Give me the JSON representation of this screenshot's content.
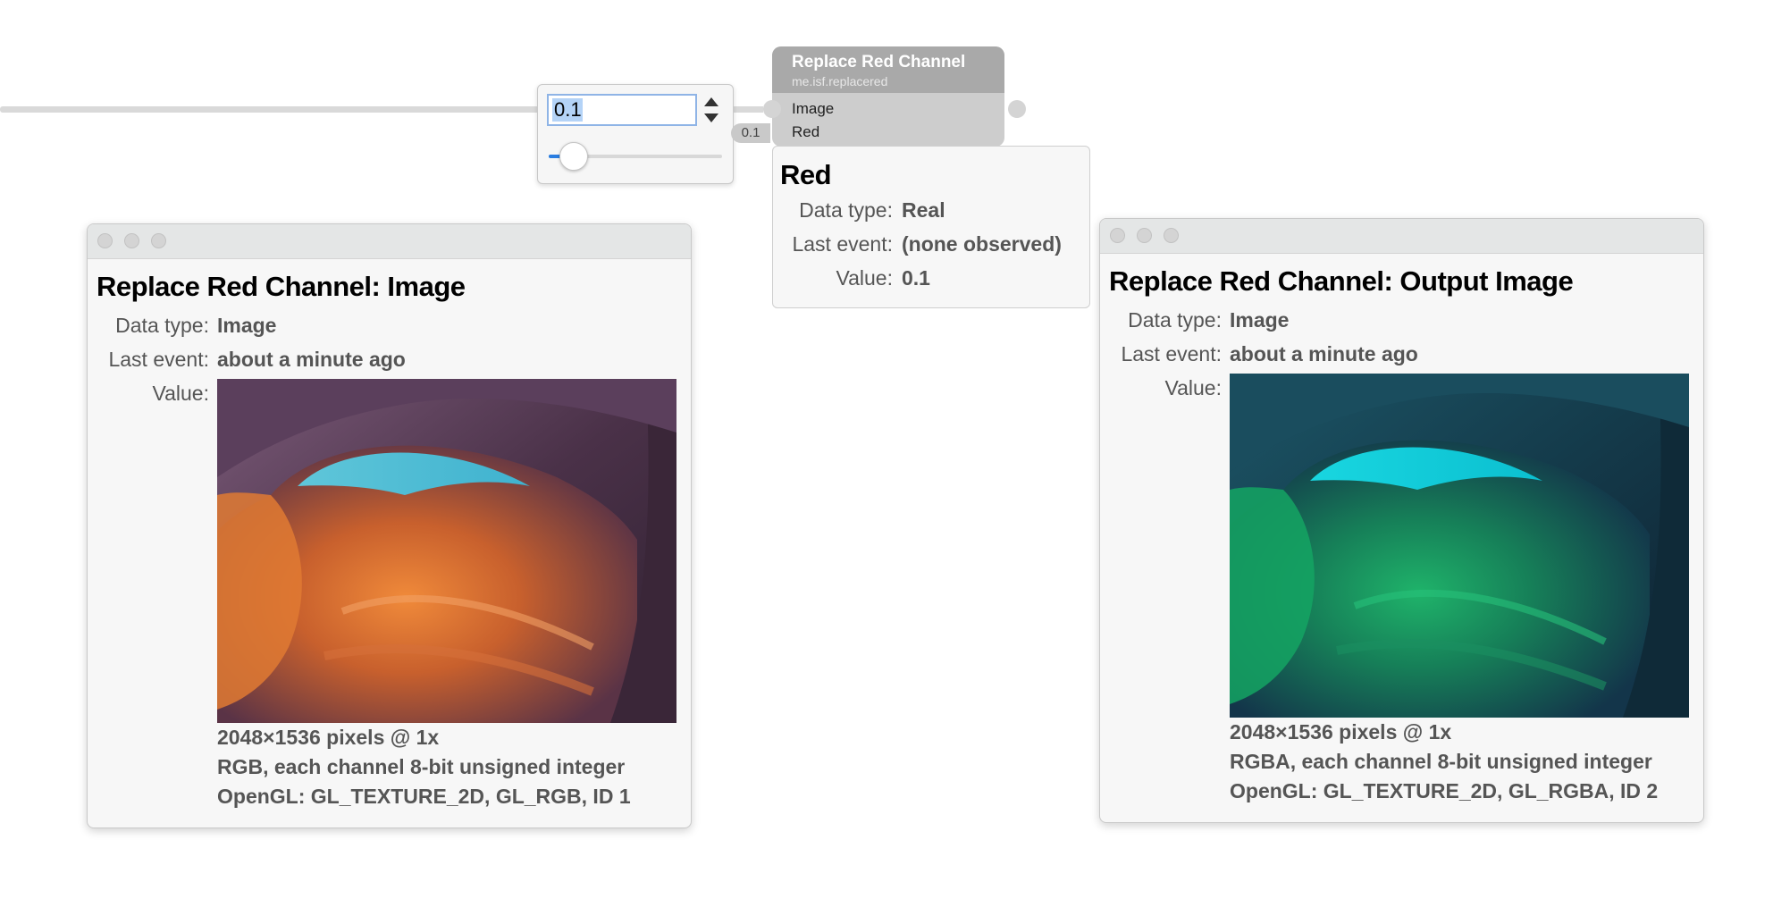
{
  "number_widget": {
    "value": "0.1",
    "slider_fraction": 0.1
  },
  "node": {
    "title": "Replace Red Channel",
    "identifier": "me.isf.replacered",
    "ports": {
      "image_label": "Image",
      "red_label": "Red",
      "red_constant": "0.1"
    }
  },
  "red_panel": {
    "title": "Red",
    "data_type_label": "Data type:",
    "data_type_value": "Real",
    "last_event_label": "Last event:",
    "last_event_value": "(none observed)",
    "value_label": "Value:",
    "value_value": "0.1"
  },
  "input_window": {
    "title": "Replace Red Channel: Image",
    "data_type_label": "Data type:",
    "data_type_value": "Image",
    "last_event_label": "Last event:",
    "last_event_value": "about a minute ago",
    "value_label": "Value:",
    "dimensions": "2048×1536 pixels @ 1x",
    "format": "RGB, each channel 8-bit unsigned integer",
    "opengl": "OpenGL: GL_TEXTURE_2D, GL_RGB, ID 1"
  },
  "output_window": {
    "title": "Replace Red Channel: Output Image",
    "data_type_label": "Data type:",
    "data_type_value": "Image",
    "last_event_label": "Last event:",
    "last_event_value": "about a minute ago",
    "value_label": "Value:",
    "dimensions": "2048×1536 pixels @ 1x",
    "format": "RGBA, each channel 8-bit unsigned integer",
    "opengl": "OpenGL: GL_TEXTURE_2D, GL_RGBA, ID 2"
  },
  "colors": {
    "accent": "#2a7de1",
    "node_header": "#a9a9a9",
    "node_body": "#cdcdcd",
    "panel_bg": "#f7f7f7"
  }
}
